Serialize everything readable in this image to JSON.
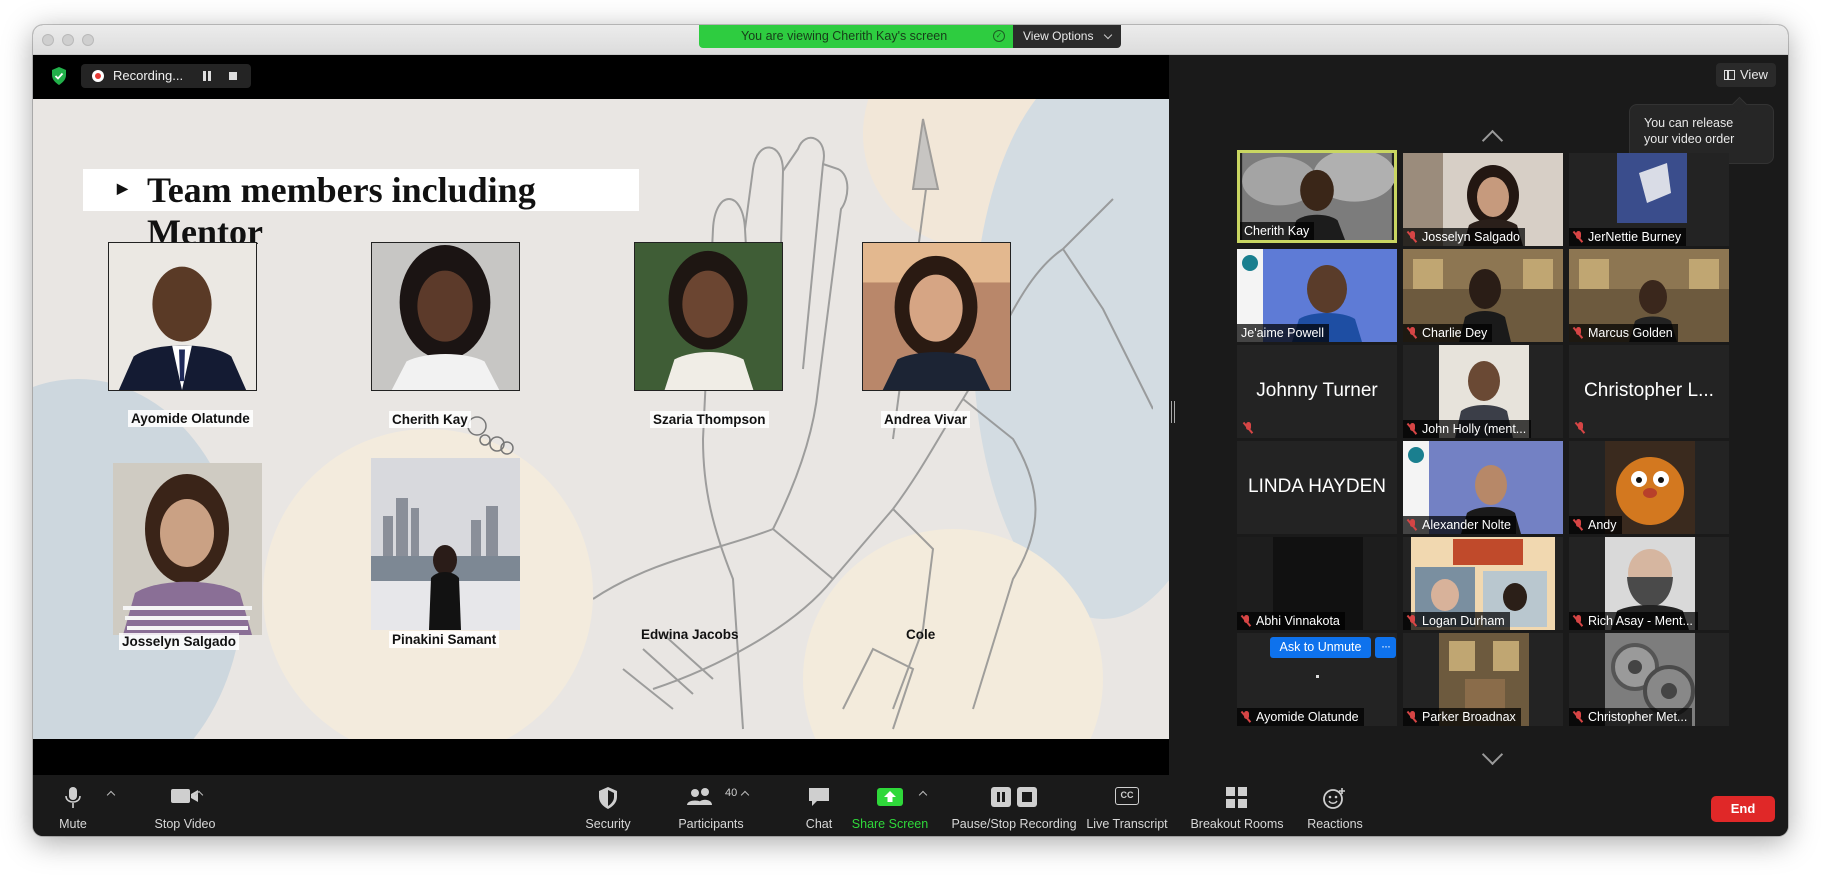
{
  "banner": {
    "viewing_text": "You are viewing Cherith Kay's screen",
    "view_options_label": "View Options"
  },
  "recording": {
    "label": "Recording..."
  },
  "slide": {
    "title": "Team members including Mentor",
    "members": [
      {
        "name": "Ayomide Olatunde"
      },
      {
        "name": "Cherith Kay"
      },
      {
        "name": "Szaria Thompson"
      },
      {
        "name": "Andrea Vivar"
      },
      {
        "name": "Josselyn Salgado"
      },
      {
        "name": "Pinakini  Samant"
      },
      {
        "name": "Edwina Jacobs"
      },
      {
        "name": "Cole"
      }
    ]
  },
  "side": {
    "view_label": "View",
    "tooltip": "You can release your video order",
    "ask_to_unmute": "Ask to Unmute",
    "more": "···",
    "participants": [
      {
        "name": "Cherith Kay",
        "muted": false
      },
      {
        "name": "Josselyn Salgado",
        "muted": true
      },
      {
        "name": "JerNettie Burney",
        "muted": true
      },
      {
        "name": "Je'aime Powell",
        "muted": false
      },
      {
        "name": "Charlie Dey",
        "muted": true
      },
      {
        "name": "Marcus Golden",
        "muted": true
      },
      {
        "name": "Johnny Turner",
        "muted": true
      },
      {
        "name": "John Holly (ment...",
        "muted": true
      },
      {
        "name": "Christopher L...",
        "muted": true
      },
      {
        "name": "LINDA HAYDEN",
        "muted": true
      },
      {
        "name": "Alexander Nolte",
        "muted": true
      },
      {
        "name": "Andy",
        "muted": true
      },
      {
        "name": "Abhi Vinnakota",
        "muted": true
      },
      {
        "name": "Logan Durham",
        "muted": true
      },
      {
        "name": "Rich Asay - Ment...",
        "muted": true
      },
      {
        "name": "Ayomide Olatunde",
        "muted": true
      },
      {
        "name": "Parker Broadnax",
        "muted": true
      },
      {
        "name": "Christopher Met...",
        "muted": true
      }
    ]
  },
  "toolbar": {
    "mute": "Mute",
    "stop_video": "Stop Video",
    "security": "Security",
    "participants": "Participants",
    "participants_count": "40",
    "chat": "Chat",
    "share_screen": "Share Screen",
    "pause_stop_recording": "Pause/Stop Recording",
    "cc": "CC",
    "live_transcript": "Live Transcript",
    "breakout_rooms": "Breakout Rooms",
    "reactions": "Reactions",
    "end": "End"
  },
  "colors": {
    "banner_green": "#2ecc40",
    "share_green": "#2fd83a",
    "end_red": "#e02828",
    "active_speaker_border": "#c9d662",
    "unmute_blue": "#0e72ed"
  }
}
